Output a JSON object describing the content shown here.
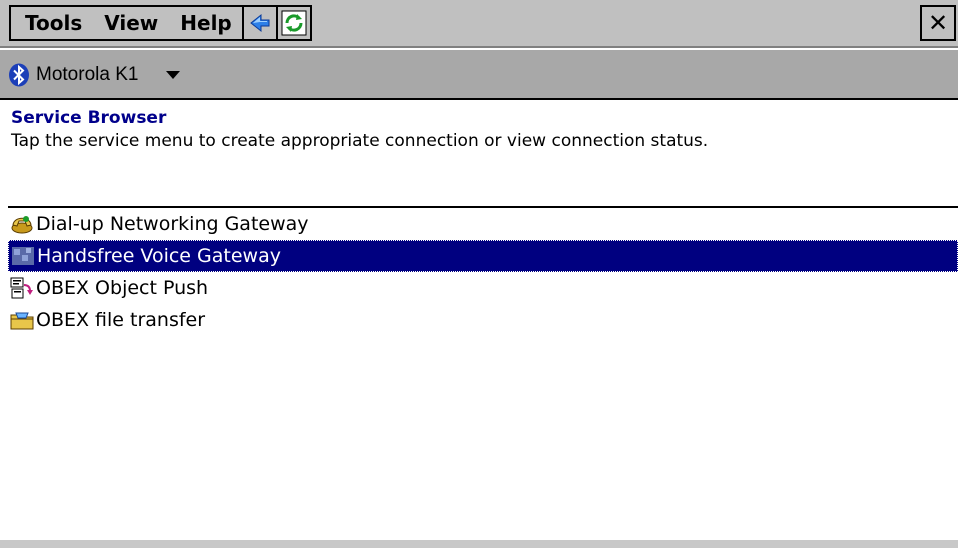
{
  "menubar": {
    "items": [
      "Tools",
      "View",
      "Help"
    ],
    "back_icon": "back-arrow-icon",
    "refresh_icon": "refresh-icon",
    "close_label": "✕"
  },
  "device": {
    "name": "Motorola K1",
    "icon": "bluetooth-icon"
  },
  "browser": {
    "title": "Service Browser",
    "description": "Tap the service menu to create appropriate connection or view connection status."
  },
  "services": [
    {
      "label": "Dial-up Networking Gateway",
      "icon": "dialup-phone-icon",
      "selected": false
    },
    {
      "label": "Handsfree Voice Gateway",
      "icon": "handsfree-icon",
      "selected": true
    },
    {
      "label": "OBEX Object Push",
      "icon": "object-push-icon",
      "selected": false
    },
    {
      "label": "OBEX file transfer",
      "icon": "file-transfer-icon",
      "selected": false
    }
  ],
  "colors": {
    "selection": "#000080",
    "title": "#00008b",
    "toolbar": "#c0c0c0",
    "devicebar": "#a8a8a8"
  }
}
